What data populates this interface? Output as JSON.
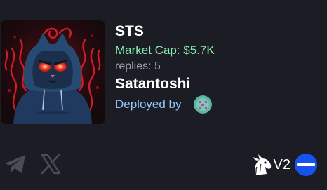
{
  "coin": {
    "ticker": "STS",
    "market_cap": "Market Cap: $5.7K",
    "replies": "replies: 5",
    "name": "Satantoshi",
    "deployed_label": "Deployed by",
    "image_icon": "hooded-devil-cat-image"
  },
  "footer": {
    "socials": [
      "telegram-icon",
      "x-icon"
    ],
    "version": "V2",
    "dex_icon": "unicorn-icon",
    "chain_icon": "base-chain-icon"
  },
  "colors": {
    "background": "#1b1c24",
    "market_cap": "#86efac",
    "replies": "#9ca3af",
    "deployed": "#93c5fd",
    "chain": "#1652f0"
  }
}
